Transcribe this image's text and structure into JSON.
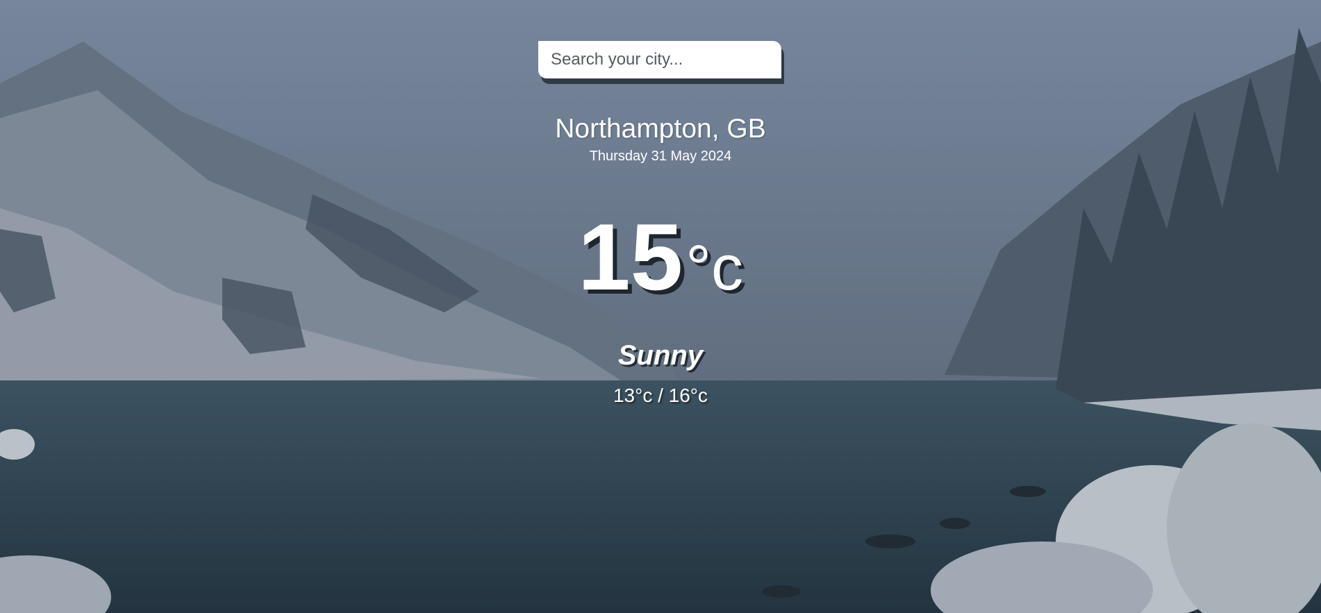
{
  "search": {
    "placeholder": "Search your city...",
    "value": ""
  },
  "location": {
    "city": "Northampton, GB",
    "date": "Thursday 31 May 2024"
  },
  "current": {
    "temperature": "15",
    "unit": "°c",
    "condition": "Sunny",
    "range": "13°c / 16°c"
  },
  "colors": {
    "text": "#ffffff",
    "search_shadow": "#2f3a45",
    "text_shadow": "#1e2730"
  }
}
